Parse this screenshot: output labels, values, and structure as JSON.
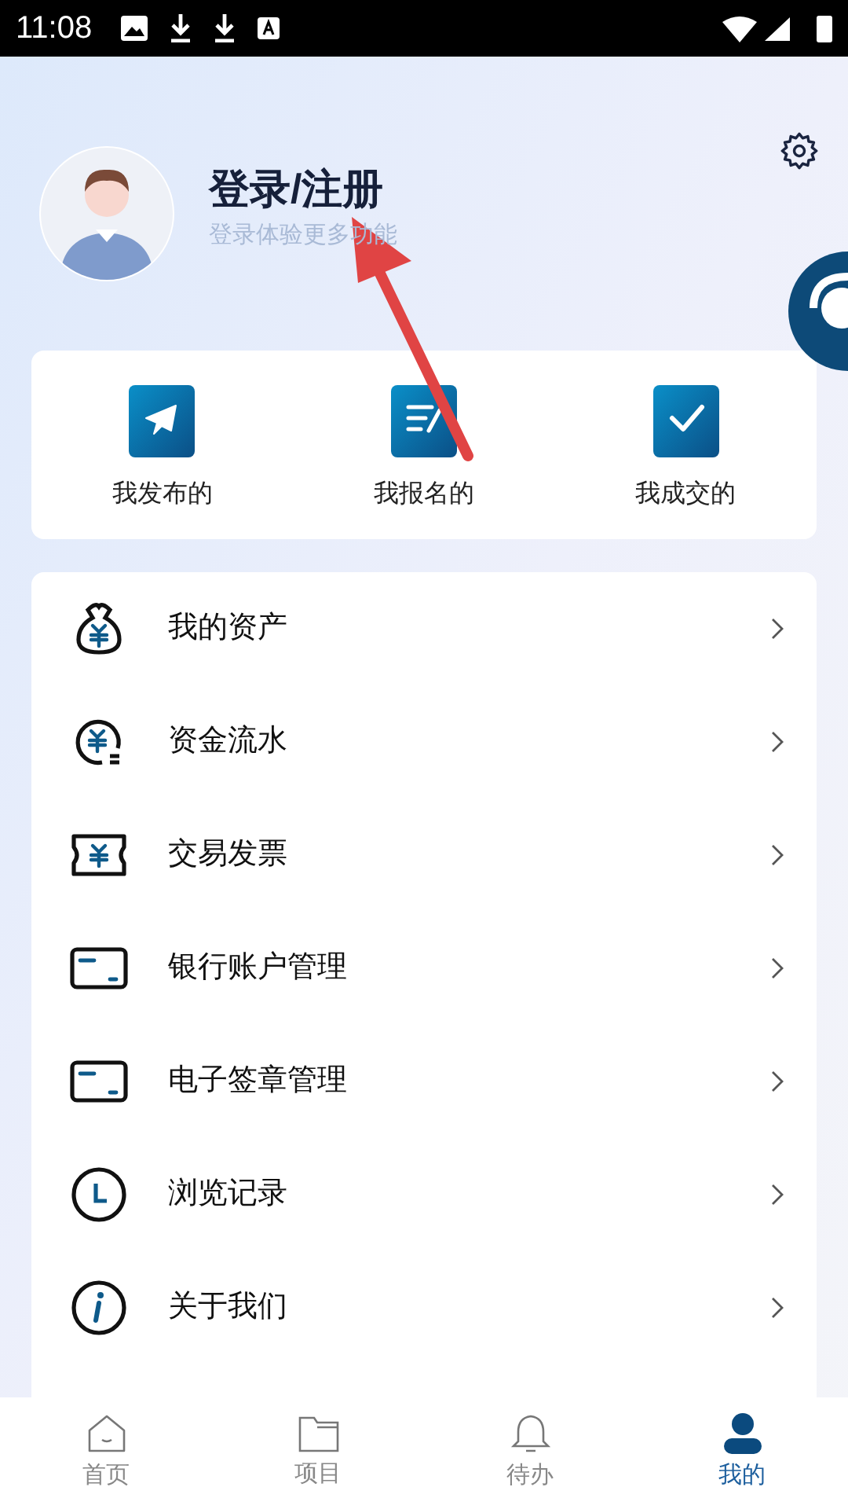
{
  "status_bar": {
    "time": "11:08"
  },
  "profile": {
    "title": "登录/注册",
    "subtitle": "登录体验更多功能"
  },
  "quick_actions": [
    {
      "kind": "send",
      "label": "我发布的"
    },
    {
      "kind": "form",
      "label": "我报名的"
    },
    {
      "kind": "check",
      "label": "我成交的"
    }
  ],
  "menu": [
    {
      "kind": "bag",
      "label": "我的资产"
    },
    {
      "kind": "coin",
      "label": "资金流水"
    },
    {
      "kind": "ticket",
      "label": "交易发票"
    },
    {
      "kind": "card",
      "label": "银行账户管理"
    },
    {
      "kind": "card",
      "label": "电子签章管理"
    },
    {
      "kind": "clock",
      "label": "浏览记录"
    },
    {
      "kind": "info",
      "label": "关于我们"
    }
  ],
  "tab_bar": [
    {
      "kind": "home",
      "label": "首页",
      "selected": false
    },
    {
      "kind": "folder",
      "label": "项目",
      "selected": false
    },
    {
      "kind": "bell",
      "label": "待办",
      "selected": false
    },
    {
      "kind": "person",
      "label": "我的",
      "selected": true
    }
  ]
}
